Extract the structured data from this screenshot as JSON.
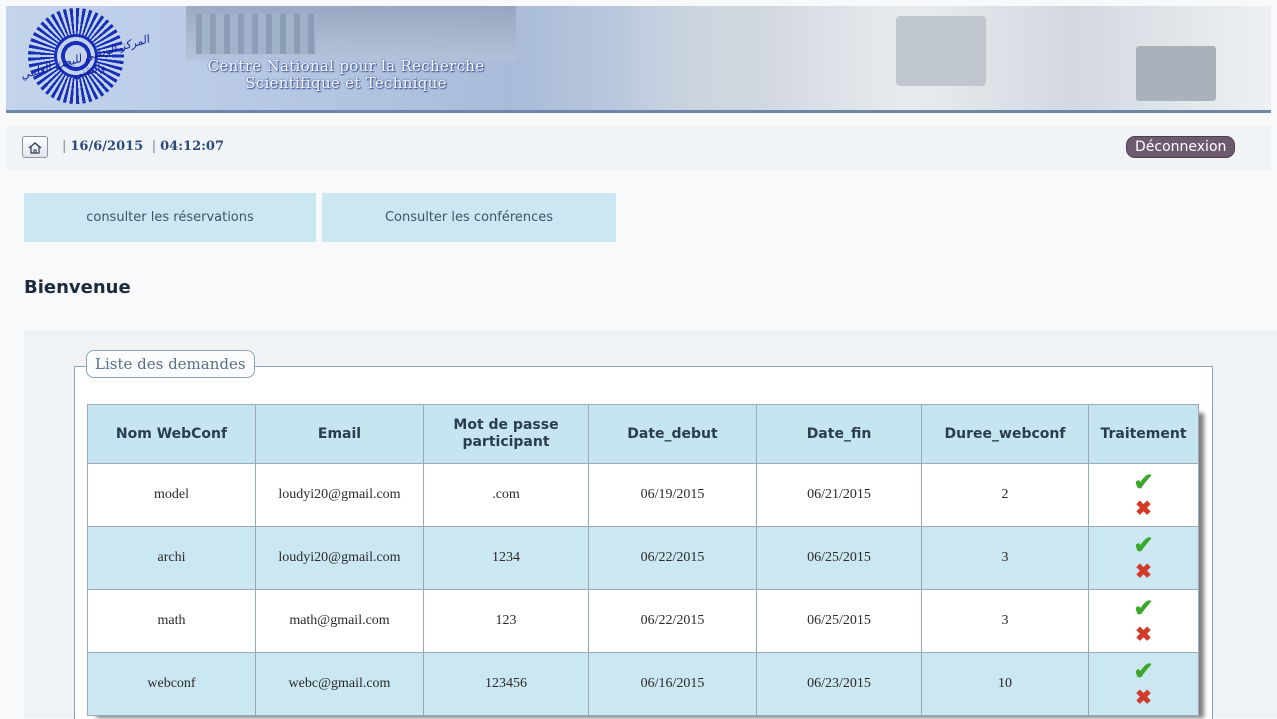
{
  "banner": {
    "title_line1": "Centre National pour la Recherche",
    "title_line2": "Scientifique et Technique",
    "logo_arabic": "المركز الوطني للبحث العلمي والتقني"
  },
  "topbar": {
    "date": "16/6/2015",
    "time": "04:12:07",
    "logout_label": "Déconnexion"
  },
  "nav": {
    "reservations_label": "consulter les réservations",
    "conferences_label": "Consulter les conférences"
  },
  "welcome": "Bienvenue",
  "panel": {
    "legend": "Liste des demandes"
  },
  "table": {
    "headers": [
      "Nom WebConf",
      "Email",
      "Mot de passe participant",
      "Date_debut",
      "Date_fin",
      "Duree_webconf",
      "Traitement"
    ],
    "rows": [
      [
        "model",
        "loudyi20@gmail.com",
        ".com",
        "06/19/2015",
        "06/21/2015",
        "2"
      ],
      [
        "archi",
        "loudyi20@gmail.com",
        "1234",
        "06/22/2015",
        "06/25/2015",
        "3"
      ],
      [
        "math",
        "math@gmail.com",
        "123",
        "06/22/2015",
        "06/25/2015",
        "3"
      ],
      [
        "webconf",
        "webc@gmail.com",
        "123456",
        "06/16/2015",
        "06/23/2015",
        "10"
      ]
    ],
    "accept_icon": "checkmark-icon",
    "reject_icon": "cross-icon"
  },
  "colors": {
    "accept": "#3aa82a",
    "reject": "#d23a2a",
    "row_highlight": "#cbe7f2",
    "header_bg": "#c7e4f1"
  }
}
